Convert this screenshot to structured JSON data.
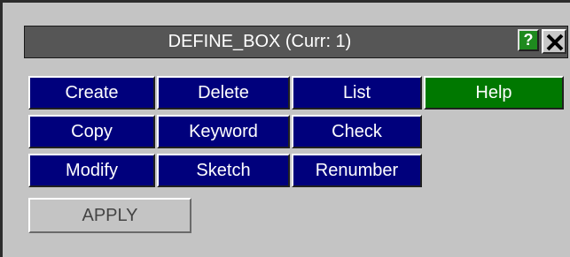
{
  "window": {
    "title": "DEFINE_BOX (Curr: 1)",
    "help_label": "?",
    "close_icon": "close-x-icon"
  },
  "buttons": {
    "create": "Create",
    "delete": "Delete",
    "list": "List",
    "help": "Help",
    "copy": "Copy",
    "keyword": "Keyword",
    "check": "Check",
    "modify": "Modify",
    "sketch": "Sketch",
    "renumber": "Renumber"
  },
  "apply_label": "APPLY",
  "colors": {
    "panel_bg": "#c4c4c4",
    "titlebar_bg": "#565656",
    "button_blue": "#00007c",
    "button_green": "#007800"
  }
}
